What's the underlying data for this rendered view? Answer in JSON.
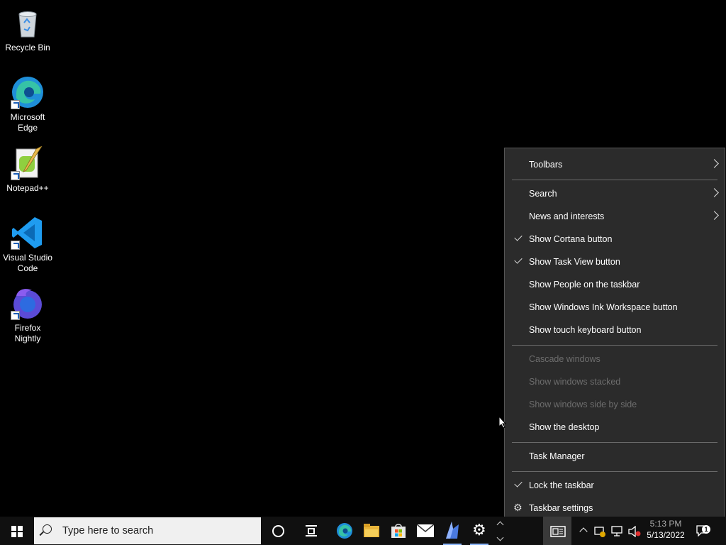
{
  "desktop": {
    "icons": [
      {
        "label_line1": "Recycle Bin",
        "label_line2": "",
        "icon": "recycle-bin-icon"
      },
      {
        "label_line1": "Microsoft",
        "label_line2": "Edge",
        "icon": "edge-icon"
      },
      {
        "label_line1": "Notepad++",
        "label_line2": "",
        "icon": "notepad-plus-plus-icon"
      },
      {
        "label_line1": "Visual Studio",
        "label_line2": "Code",
        "icon": "vscode-icon"
      },
      {
        "label_line1": "Firefox",
        "label_line2": "Nightly",
        "icon": "firefox-nightly-icon"
      }
    ]
  },
  "context_menu": {
    "items": [
      {
        "label": "Toolbars",
        "submenu": true,
        "checked": false,
        "enabled": true
      },
      {
        "label": "Search",
        "submenu": true,
        "checked": false,
        "enabled": true
      },
      {
        "label": "News and interests",
        "submenu": true,
        "checked": false,
        "enabled": true
      },
      {
        "label": "Show Cortana button",
        "submenu": false,
        "checked": true,
        "enabled": true
      },
      {
        "label": "Show Task View button",
        "submenu": false,
        "checked": true,
        "enabled": true
      },
      {
        "label": "Show People on the taskbar",
        "submenu": false,
        "checked": false,
        "enabled": true
      },
      {
        "label": "Show Windows Ink Workspace button",
        "submenu": false,
        "checked": false,
        "enabled": true
      },
      {
        "label": "Show touch keyboard button",
        "submenu": false,
        "checked": false,
        "enabled": true
      },
      {
        "label": "Cascade windows",
        "submenu": false,
        "checked": false,
        "enabled": false
      },
      {
        "label": "Show windows stacked",
        "submenu": false,
        "checked": false,
        "enabled": false
      },
      {
        "label": "Show windows side by side",
        "submenu": false,
        "checked": false,
        "enabled": false
      },
      {
        "label": "Show the desktop",
        "submenu": false,
        "checked": false,
        "enabled": true
      },
      {
        "label": "Task Manager",
        "submenu": false,
        "checked": false,
        "enabled": true
      },
      {
        "label": "Lock the taskbar",
        "submenu": false,
        "checked": true,
        "enabled": true
      },
      {
        "label": "Taskbar settings",
        "submenu": false,
        "checked": false,
        "enabled": true,
        "icon": "gear-icon"
      }
    ]
  },
  "taskbar": {
    "search_placeholder": "Type here to search",
    "pinned_apps": [
      "edge-icon",
      "file-explorer-icon",
      "microsoft-store-icon",
      "mail-icon",
      "app-icon",
      "settings-icon"
    ],
    "clock_time": "5:13 PM",
    "clock_date": "5/13/2022",
    "notification_count": "1"
  },
  "colors": {
    "menu_bg": "#2b2b2b",
    "taskbar_bg": "#101010",
    "desktop_bg": "#000000",
    "disabled_text": "#6d6d6d"
  }
}
